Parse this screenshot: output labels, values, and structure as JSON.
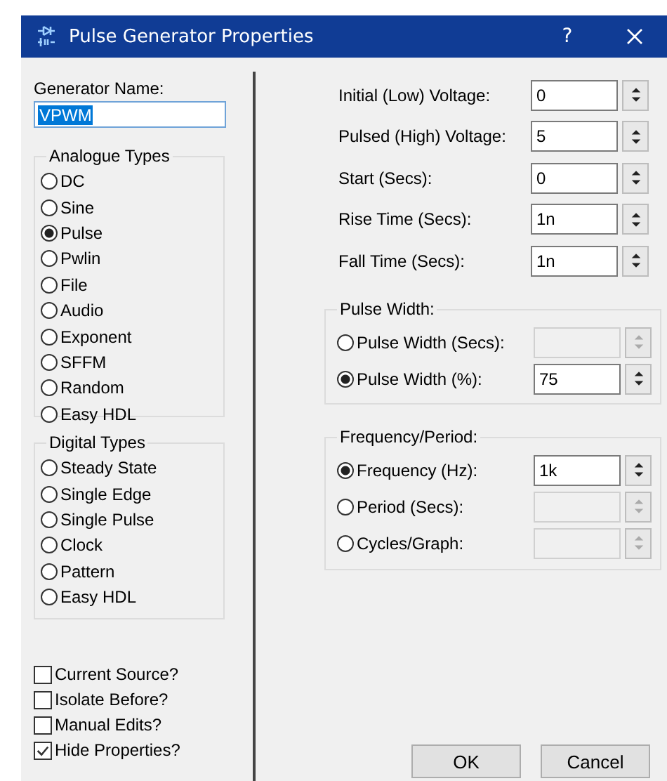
{
  "window": {
    "title": "Pulse Generator Properties",
    "help": "?"
  },
  "generator_name": {
    "label": "Generator Name:",
    "value": "VPWM",
    "text_selected": true
  },
  "analogue_types": {
    "title": "Analogue Types",
    "options": [
      {
        "label": "DC",
        "selected": false
      },
      {
        "label": "Sine",
        "selected": false
      },
      {
        "label": "Pulse",
        "selected": true
      },
      {
        "label": "Pwlin",
        "selected": false
      },
      {
        "label": "File",
        "selected": false
      },
      {
        "label": "Audio",
        "selected": false
      },
      {
        "label": "Exponent",
        "selected": false
      },
      {
        "label": "SFFM",
        "selected": false
      },
      {
        "label": "Random",
        "selected": false
      },
      {
        "label": "Easy HDL",
        "selected": false
      }
    ]
  },
  "digital_types": {
    "title": "Digital Types",
    "options": [
      {
        "label": "Steady State",
        "selected": false
      },
      {
        "label": "Single Edge",
        "selected": false
      },
      {
        "label": "Single Pulse",
        "selected": false
      },
      {
        "label": "Clock",
        "selected": false
      },
      {
        "label": "Pattern",
        "selected": false
      },
      {
        "label": "Easy HDL",
        "selected": false
      }
    ]
  },
  "checkboxes": [
    {
      "label": "Current Source?",
      "checked": false
    },
    {
      "label": "Isolate Before?",
      "checked": false
    },
    {
      "label": "Manual Edits?",
      "checked": false
    },
    {
      "label": "Hide Properties?",
      "checked": true
    }
  ],
  "parameters": [
    {
      "label": "Initial (Low) Voltage:",
      "value": "0"
    },
    {
      "label": "Pulsed (High) Voltage:",
      "value": "5"
    },
    {
      "label": "Start (Secs):",
      "value": "0"
    },
    {
      "label": "Rise Time (Secs):",
      "value": "1n"
    },
    {
      "label": "Fall Time (Secs):",
      "value": "1n"
    }
  ],
  "pulse_width": {
    "title": "Pulse Width:",
    "options": [
      {
        "label": "Pulse Width (Secs):",
        "selected": false
      },
      {
        "label": "Pulse Width (%):",
        "selected": true,
        "value": "75"
      }
    ]
  },
  "frequency_period": {
    "title": "Frequency/Period:",
    "options": [
      {
        "label": "Frequency (Hz):",
        "selected": true,
        "value": "1k"
      },
      {
        "label": "Period (Secs):",
        "selected": false
      },
      {
        "label": "Cycles/Graph:",
        "selected": false
      }
    ]
  },
  "buttons": [
    {
      "label": "OK"
    },
    {
      "label": "Cancel"
    }
  ]
}
